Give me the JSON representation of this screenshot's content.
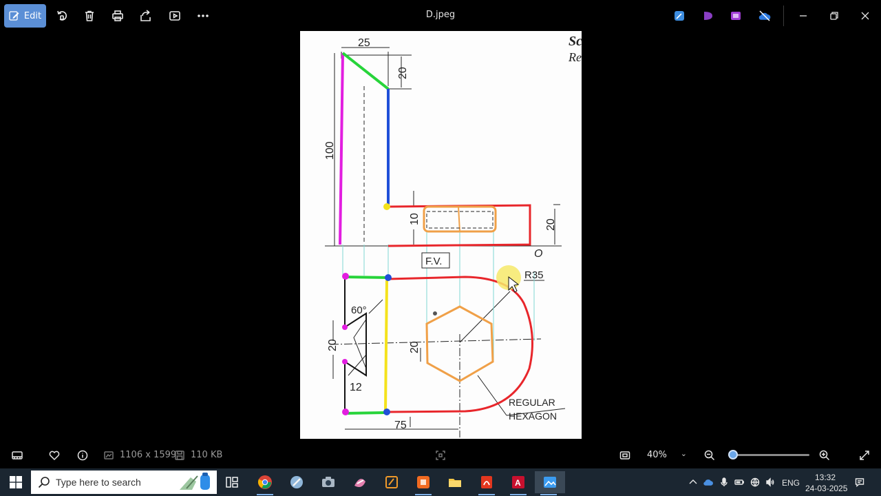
{
  "window": {
    "title": "D.jpeg",
    "edit_label": "Edit"
  },
  "drawing": {
    "dims": {
      "top_width": "25",
      "top_drop": "20",
      "height": "100",
      "slot_depth": "10",
      "base_thickness": "20",
      "origin": "O",
      "radius": "R35",
      "fv_label": "F.V.",
      "angle": "60°",
      "left_gap": "20",
      "hex_size": "20",
      "notch": "12",
      "length": "75",
      "note_line1": "REGULAR",
      "note_line2": "HEXAGON",
      "corner_text1": "Sc",
      "corner_text2": "Re"
    }
  },
  "status": {
    "dimensions": "1106 x 1599",
    "file_size": "110 KB",
    "zoom": "40%",
    "zoom_fraction": 0.06
  },
  "taskbar": {
    "search_placeholder": "Type here to search",
    "language": "ENG",
    "time": "13:32",
    "date": "24-03-2025"
  },
  "colors": {
    "accent": "#5b8fd6",
    "taskbar": "#1b2631",
    "red": "#e8262b",
    "magenta": "#e21ee0",
    "blue": "#1f4fd8",
    "green": "#27d43a",
    "yellow": "#f4e21c",
    "orange": "#f0a048",
    "cyan": "#7fd8d2"
  }
}
